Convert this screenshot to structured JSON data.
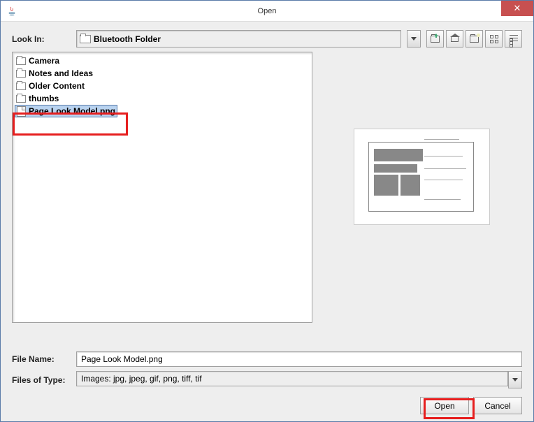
{
  "title": "Open",
  "lookin": {
    "label": "Look In:",
    "folder": "Bluetooth Folder"
  },
  "files": [
    {
      "name": "Camera",
      "type": "folder"
    },
    {
      "name": "Notes and Ideas",
      "type": "folder"
    },
    {
      "name": "Older Content",
      "type": "folder"
    },
    {
      "name": "thumbs",
      "type": "folder"
    },
    {
      "name": "Page Look Model.png",
      "type": "file",
      "selected": true
    }
  ],
  "filename": {
    "label": "File Name:",
    "value": "Page Look Model.png"
  },
  "filetype": {
    "label": "Files of Type:",
    "value": "Images: jpg, jpeg, gif, png, tiff, tif"
  },
  "buttons": {
    "open": "Open",
    "cancel": "Cancel"
  }
}
